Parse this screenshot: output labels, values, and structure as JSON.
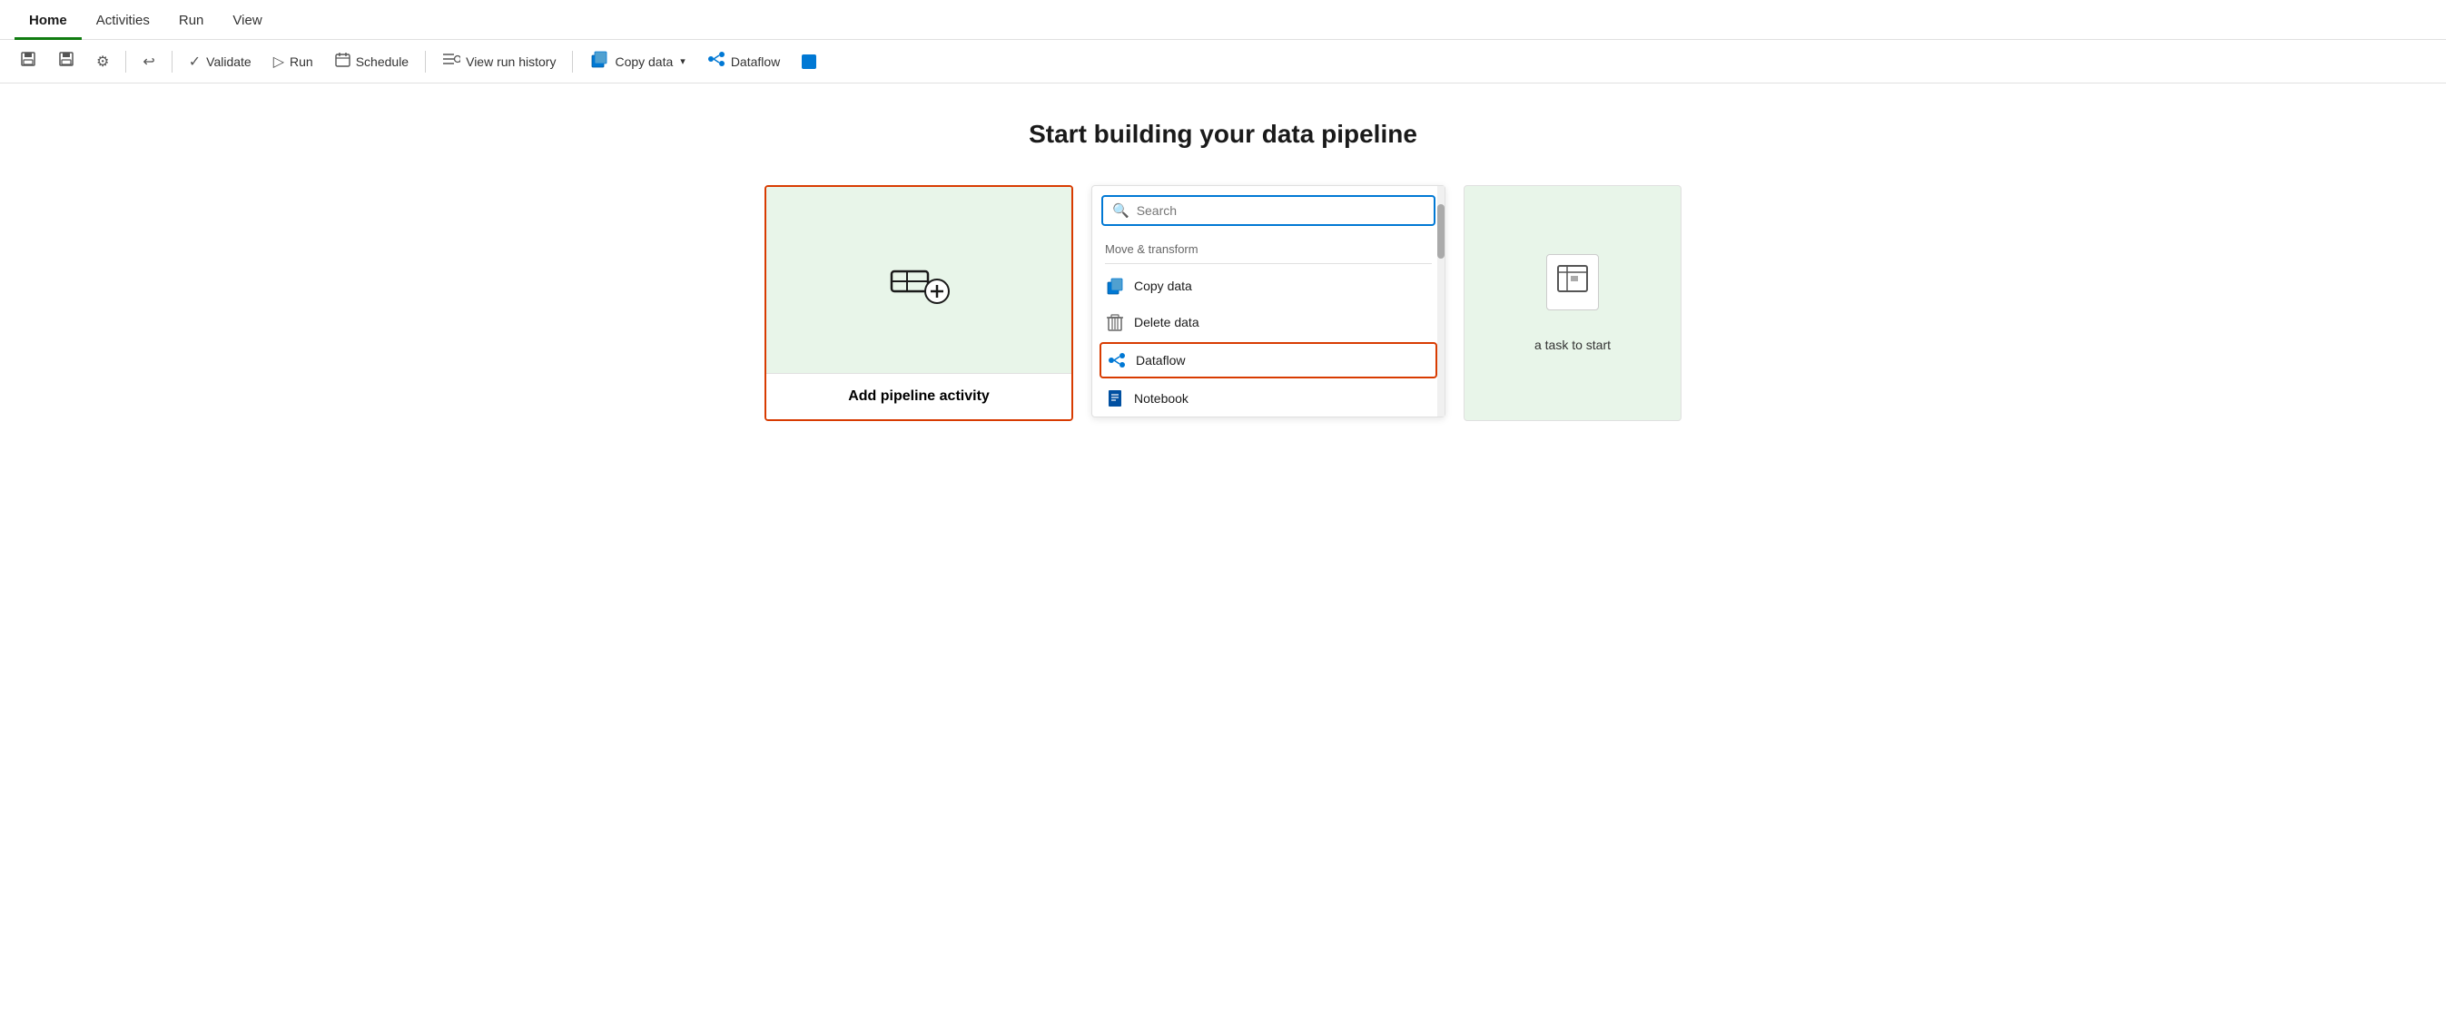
{
  "nav": {
    "tabs": [
      {
        "id": "home",
        "label": "Home",
        "active": true
      },
      {
        "id": "activities",
        "label": "Activities",
        "active": false
      },
      {
        "id": "run",
        "label": "Run",
        "active": false
      },
      {
        "id": "view",
        "label": "View",
        "active": false
      }
    ]
  },
  "toolbar": {
    "save_icon": "💾",
    "save_label": "",
    "saveas_label": "",
    "settings_label": "",
    "undo_label": "",
    "validate_label": "Validate",
    "run_label": "Run",
    "schedule_label": "Schedule",
    "view_run_history_label": "View run history",
    "copy_data_label": "Copy data",
    "dataflow_label": "Dataflow"
  },
  "main": {
    "title": "Start building your data pipeline",
    "add_pipeline_label": "Add pipeline activity"
  },
  "activities_panel": {
    "search_placeholder": "Search",
    "section_label": "Move & transform",
    "items": [
      {
        "id": "copy-data",
        "label": "Copy data",
        "icon": "copy"
      },
      {
        "id": "delete-data",
        "label": "Delete data",
        "icon": "delete"
      },
      {
        "id": "dataflow",
        "label": "Dataflow",
        "icon": "dataflow",
        "selected": true
      },
      {
        "id": "notebook",
        "label": "Notebook",
        "icon": "notebook"
      }
    ]
  },
  "right_card": {
    "text": "a task to start"
  },
  "colors": {
    "active_tab_border": "#107c10",
    "selected_border": "#d83b01",
    "search_border": "#0078d4"
  }
}
